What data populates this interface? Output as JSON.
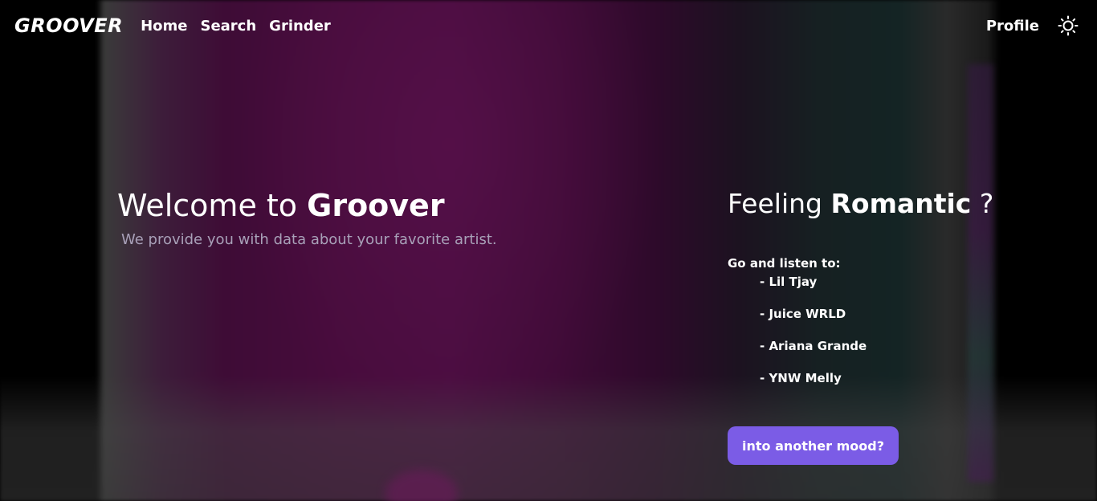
{
  "header": {
    "logo": "GROOVER",
    "nav": [
      {
        "label": "Home"
      },
      {
        "label": "Search"
      },
      {
        "label": "Grinder"
      }
    ],
    "profile_label": "Profile",
    "theme_icon": "sun-icon"
  },
  "hero": {
    "title_prefix": "Welcome to ",
    "title_brand": "Groover",
    "subtitle": "We provide you with data about your favorite artist."
  },
  "mood": {
    "prefix": "Feeling ",
    "name": "Romantic",
    "suffix": " ?",
    "listen_label": "Go and listen to:",
    "artists": [
      "- Lil Tjay",
      "- Juice WRLD",
      "- Ariana Grande",
      "- YNW Melly"
    ],
    "button_label": "into another mood?"
  },
  "colors": {
    "accent": "#7b5ce6",
    "subtitle": "#a8a0b8",
    "background": "#000000"
  }
}
